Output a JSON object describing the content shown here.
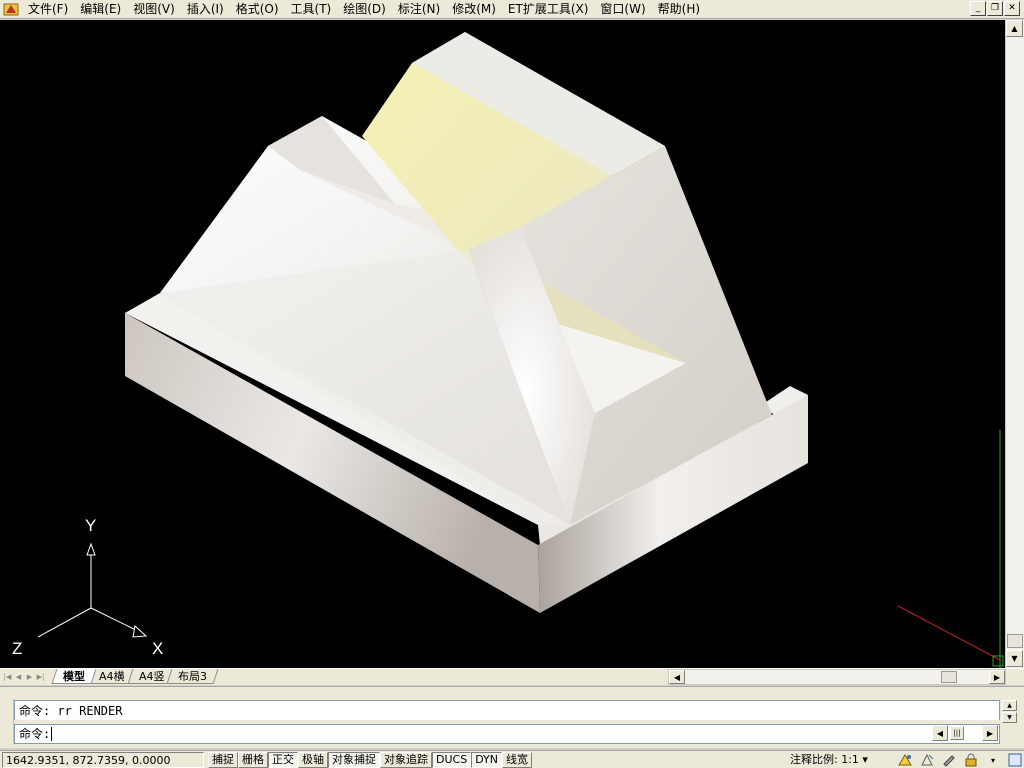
{
  "menu": {
    "items": [
      "文件(F)",
      "编辑(E)",
      "视图(V)",
      "插入(I)",
      "格式(O)",
      "工具(T)",
      "绘图(D)",
      "标注(N)",
      "修改(M)",
      "ET扩展工具(X)",
      "窗口(W)",
      "帮助(H)"
    ]
  },
  "window_controls": {
    "minimize": "_",
    "restore": "❐",
    "close": "✕"
  },
  "ucs": {
    "y": "Y",
    "x": "X",
    "z": "Z"
  },
  "layout_tabs": {
    "items": [
      "模型",
      "A4横",
      "A4竖",
      "布局3"
    ],
    "active_index": 0
  },
  "command": {
    "history": "命令: rr RENDER",
    "prompt": "命令:"
  },
  "status": {
    "coordinates": "1642.9351, 872.7359, 0.0000",
    "toggles": [
      {
        "label": "捕捉",
        "on": false
      },
      {
        "label": "栅格",
        "on": false
      },
      {
        "label": "正交",
        "on": true
      },
      {
        "label": "极轴",
        "on": false
      },
      {
        "label": "对象捕捉",
        "on": true
      },
      {
        "label": "对象追踪",
        "on": false
      },
      {
        "label": "DUCS",
        "on": true
      },
      {
        "label": "DYN",
        "on": true
      },
      {
        "label": "线宽",
        "on": false
      }
    ],
    "annotation_scale_label": "注释比例:",
    "annotation_scale_value": "1:1 ▾"
  },
  "colors": {
    "viewport_background": "#000000",
    "chrome": "#ece9d8",
    "model_highlight": "#f2f0a8"
  }
}
